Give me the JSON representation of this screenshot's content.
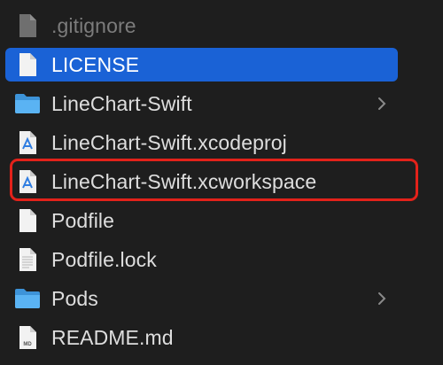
{
  "files": [
    {
      "name": ".gitignore",
      "icon": "document-icon",
      "kind": "file",
      "selected": false,
      "dimmed": true
    },
    {
      "name": "LICENSE",
      "icon": "document-icon",
      "kind": "file",
      "selected": true,
      "dimmed": false
    },
    {
      "name": "LineChart-Swift",
      "icon": "folder-icon",
      "kind": "folder",
      "selected": false,
      "dimmed": false
    },
    {
      "name": "LineChart-Swift.xcodeproj",
      "icon": "xcodeproj-icon",
      "kind": "file",
      "selected": false,
      "dimmed": false
    },
    {
      "name": "LineChart-Swift.xcworkspace",
      "icon": "xcworkspace-icon",
      "kind": "file",
      "selected": false,
      "dimmed": false,
      "highlighted": true
    },
    {
      "name": "Podfile",
      "icon": "document-icon",
      "kind": "file",
      "selected": false,
      "dimmed": false
    },
    {
      "name": "Podfile.lock",
      "icon": "document-lines-icon",
      "kind": "file",
      "selected": false,
      "dimmed": false
    },
    {
      "name": "Pods",
      "icon": "folder-icon",
      "kind": "folder",
      "selected": false,
      "dimmed": false
    },
    {
      "name": "README.md",
      "icon": "markdown-icon",
      "kind": "file",
      "selected": false,
      "dimmed": false
    }
  ],
  "icon_badges": {
    "markdown": "MD"
  },
  "colors": {
    "background": "#1e1e1e",
    "selection": "#1a62d6",
    "highlight_box": "#e3221a",
    "folder": "#4aa7f0",
    "xcode_blue": "#2f7de1"
  }
}
